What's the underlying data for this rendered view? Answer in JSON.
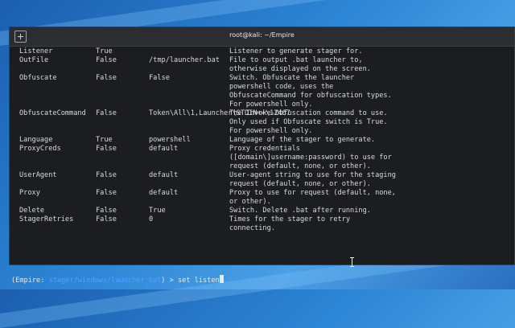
{
  "window": {
    "title": "root@kali: ~/Empire",
    "new_tab_icon": "new-tab-icon"
  },
  "rows": [
    {
      "name": "Listener",
      "required": "True",
      "value": "",
      "desc": "Listener to generate stager for."
    },
    {
      "name": "OutFile",
      "required": "False",
      "value": "/tmp/launcher.bat",
      "desc": "File to output .bat launcher to,"
    },
    {
      "name": "",
      "required": "",
      "value": "",
      "desc": "otherwise displayed on the screen."
    },
    {
      "name": "Obfuscate",
      "required": "False",
      "value": "False",
      "desc": "Switch. Obfuscate the launcher"
    },
    {
      "name": "",
      "required": "",
      "value": "",
      "desc": "powershell code, uses the"
    },
    {
      "name": "",
      "required": "",
      "value": "",
      "desc": "ObfuscateCommand for obfuscation types."
    },
    {
      "name": "",
      "required": "",
      "value": "",
      "desc": "For powershell only."
    },
    {
      "name": "ObfuscateCommand",
      "required": "False",
      "value": "Token\\All\\1,Launcher\\STDIN++\\12467",
      "desc": "The Invoke-Obfuscation command to use."
    },
    {
      "name": "",
      "required": "",
      "value": "",
      "desc": "Only used if Obfuscate switch is True."
    },
    {
      "name": "",
      "required": "",
      "value": "",
      "desc": "For powershell only."
    },
    {
      "name": "Language",
      "required": "True",
      "value": "powershell",
      "desc": "Language of the stager to generate."
    },
    {
      "name": "ProxyCreds",
      "required": "False",
      "value": "default",
      "desc": "Proxy credentials"
    },
    {
      "name": "",
      "required": "",
      "value": "",
      "desc": "([domain\\]username:password) to use for"
    },
    {
      "name": "",
      "required": "",
      "value": "",
      "desc": "request (default, none, or other)."
    },
    {
      "name": "UserAgent",
      "required": "False",
      "value": "default",
      "desc": "User-agent string to use for the staging"
    },
    {
      "name": "",
      "required": "",
      "value": "",
      "desc": "request (default, none, or other)."
    },
    {
      "name": "Proxy",
      "required": "False",
      "value": "default",
      "desc": "Proxy to use for request (default, none,"
    },
    {
      "name": "",
      "required": "",
      "value": "",
      "desc": "or other)."
    },
    {
      "name": "Delete",
      "required": "False",
      "value": "True",
      "desc": "Switch. Delete .bat after running."
    },
    {
      "name": "StagerRetries",
      "required": "False",
      "value": "0",
      "desc": "Times for the stager to retry"
    },
    {
      "name": "",
      "required": "",
      "value": "",
      "desc": "connecting."
    }
  ],
  "prompt": {
    "prefix": "(Empire: ",
    "path": "stager/windows/launcher_bat",
    "suffix": ") > ",
    "input": "set listen"
  }
}
